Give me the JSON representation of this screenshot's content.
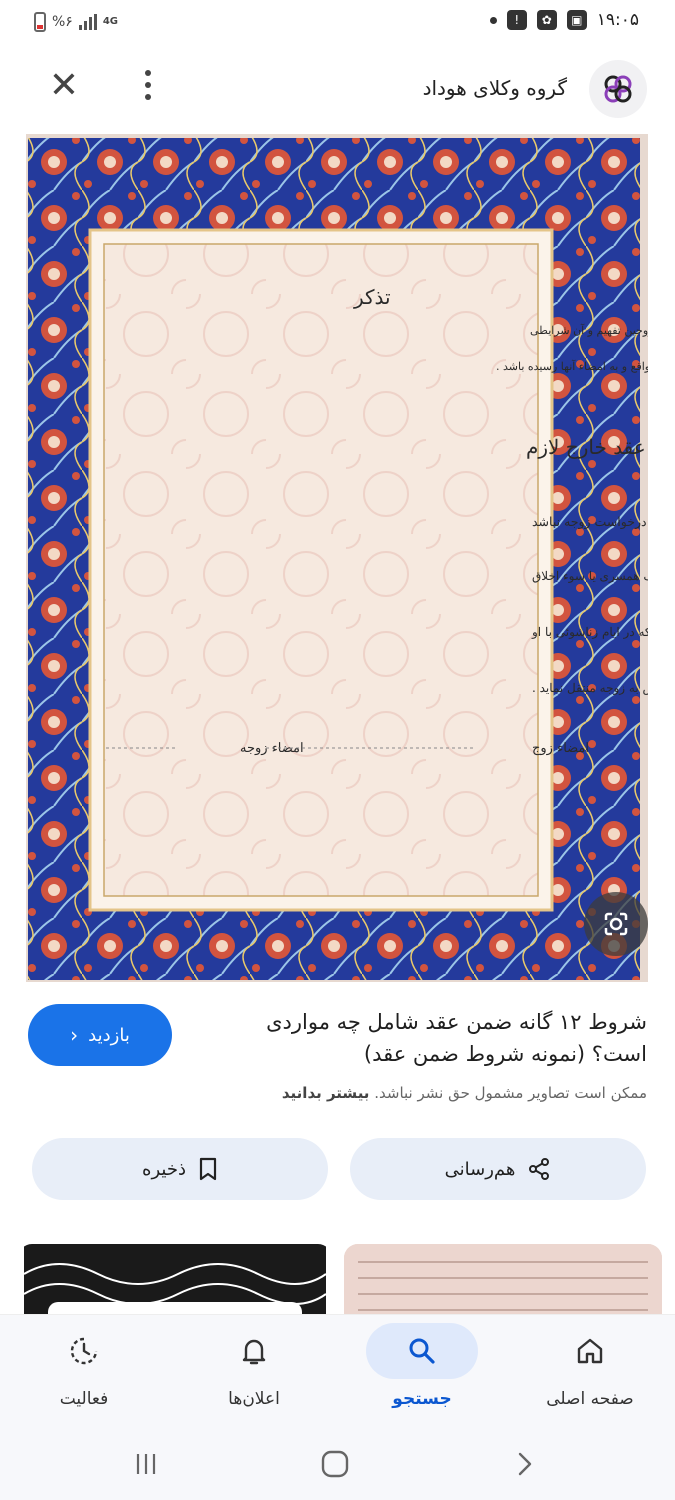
{
  "status_bar": {
    "time": "۱۹:۰۵",
    "battery": "%۶",
    "network": "4G"
  },
  "header": {
    "site_name": "گروه وکلای هوداد",
    "logo_icon": "hoodad-logo-icon",
    "close_icon": "close-icon",
    "more_icon": "more-vert-icon"
  },
  "image": {
    "heading": "تذکر",
    "intro_lines": [
      "سردفتر ازدواج مکلف است شرایط مذکور در این قباله را مورد به مورد به زوجین تفهیم و آن شرایطی",
      "مشترک است که مورد توافق زوجین واقع و به امضاء آنها رسیده باشد ."
    ],
    "subheading": "شرایط ضمن عقد یا عقد خارج لازم",
    "clause_lines": [
      "ان ضمن عقد نکاح زوجه شرط نمود هرگاه طلاق بنا به درخواست زوجه نباشد",
      "و طبق تشخیص دادگاه تقاضای طلاق ناشی از تخلف زن از وظایف همسری یا سوء اخلاق",
      "و رفتار وی نبوده زوج موظف است تا نصف دارائی موجود خود را که در ایام زناشوئی با او",
      "بدست آورده یا معادل آن را طبق نظر دادگاه بلاعوض به زوجه منتقل نماید ."
    ],
    "signature_wife": "امضاء زوجه",
    "signature_husband": "امضاء زوج"
  },
  "result": {
    "title_line1": "شروط ۱۲ گانه ضمن عقد شامل چه مواردی",
    "title_line2": "است؟ (نمونه شروط ضمن عقد)",
    "visit_label": "بازدید",
    "copyright_text": "ممکن است تصاویر مشمول حق نشر نباشد.",
    "copyright_link": "بیشتر بدانید"
  },
  "actions": {
    "share_label": "هم‌رسانی",
    "save_label": "ذخیره"
  },
  "bottom_nav": {
    "home": "صفحه اصلی",
    "search": "جستجو",
    "notifications": "اعلان‌ها",
    "activity": "فعالیت",
    "active": "search"
  },
  "colors": {
    "accent": "#1a73e8",
    "border_blue": "#243a9c",
    "border_red": "#d2543f",
    "parchment": "#f6e9df"
  }
}
